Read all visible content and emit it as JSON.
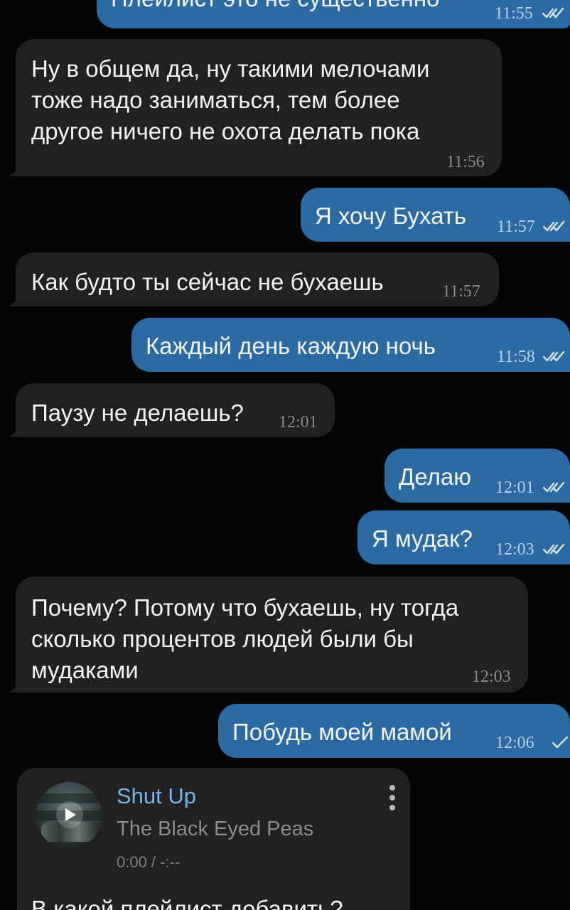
{
  "chat": {
    "messages": [
      {
        "id": "m1",
        "text": "Плейлист это не существенно",
        "time": "11:55",
        "direction": "out",
        "status": "double-check-icon"
      },
      {
        "id": "m2",
        "text": "Ну в общем да, ну такими мелочами\nтоже надо заниматься, тем более\nдругое ничего не охота делать пока",
        "time": "11:56",
        "direction": "in"
      },
      {
        "id": "m3",
        "text": "Я хочу Бухать",
        "time": "11:57",
        "direction": "out",
        "status": "double-check-icon"
      },
      {
        "id": "m4",
        "text": "Как будто ты сейчас не бухаешь",
        "time": "11:57",
        "direction": "in"
      },
      {
        "id": "m5",
        "text": "Каждый день каждую ночь",
        "time": "11:58",
        "direction": "out",
        "status": "double-check-icon"
      },
      {
        "id": "m6",
        "text": "Паузу не делаешь?",
        "time": "12:01",
        "direction": "in"
      },
      {
        "id": "m7",
        "text": "Делаю",
        "time": "12:01",
        "direction": "out",
        "status": "double-check-icon"
      },
      {
        "id": "m8",
        "text": "Я мудак?",
        "time": "12:03",
        "direction": "out",
        "status": "double-check-icon"
      },
      {
        "id": "m9",
        "text": "Почему? Потому что бухаешь, ну тогда\nсколько процентов людей были бы\nмудаками",
        "time": "12:03",
        "direction": "in"
      },
      {
        "id": "m10",
        "text": "Побудь моей мамой",
        "time": "12:06",
        "direction": "out",
        "status": "single-check-icon"
      }
    ],
    "music_card": {
      "title": "Shut Up",
      "artist": "The Black Eyed Peas",
      "progress": "0:00 / -:--",
      "caption": "В какой плейлист добавить?",
      "cover_icon": "album-cover-icon",
      "play_icon": "play-icon",
      "menu_icon": "more-vertical-icon"
    }
  },
  "colors": {
    "background": "#050505",
    "incoming_bubble": "#212121",
    "outgoing_bubble": "#2c6aa3",
    "music_title": "#74b6ec"
  }
}
